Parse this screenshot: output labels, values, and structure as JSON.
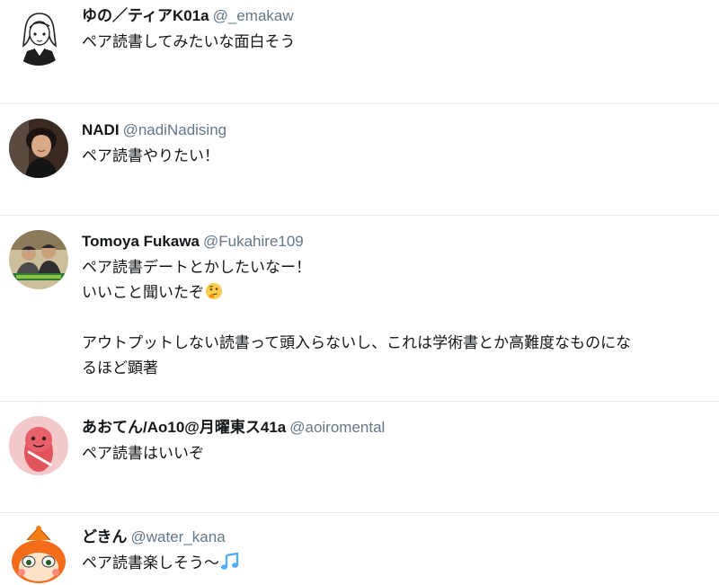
{
  "tweets": [
    {
      "display_name": "ゆの／ティアK01a",
      "handle": "@_emakaw",
      "lines": [
        "ペア読書してみたいな面白そう"
      ],
      "avatar": "anime-girl-sketch"
    },
    {
      "display_name": "NADI",
      "handle": "@nadiNadising",
      "lines": [
        "ペア読書やりたい！"
      ],
      "avatar": "woman-photo"
    },
    {
      "display_name": "Tomoya Fukawa",
      "handle": "@Fukahire109",
      "lines": [
        "ペア読書デートとかしたいなー！",
        "いいこと聞いたぞ",
        "アウトプットしない読書って頭入らないし、これは学術書とか高難度なものにな",
        "るほど顕著"
      ],
      "emoji": "thinking-face-emoji",
      "avatar": "two-men-photo"
    },
    {
      "display_name": "あおてん/Ao10@月曜東ス41a",
      "handle": "@aoiromental",
      "lines": [
        "ペア読書はいいぞ"
      ],
      "avatar": "pink-character"
    },
    {
      "display_name": "どきん",
      "handle": "@water_kana",
      "lines": [
        "ペア読書楽しそう〜"
      ],
      "emoji": "music-notes-emoji",
      "avatar": "dokin-character"
    }
  ],
  "colors": {
    "name": "#14171a",
    "handle": "#657786",
    "divider": "#e6ecf0",
    "music_note": "#55acee"
  }
}
